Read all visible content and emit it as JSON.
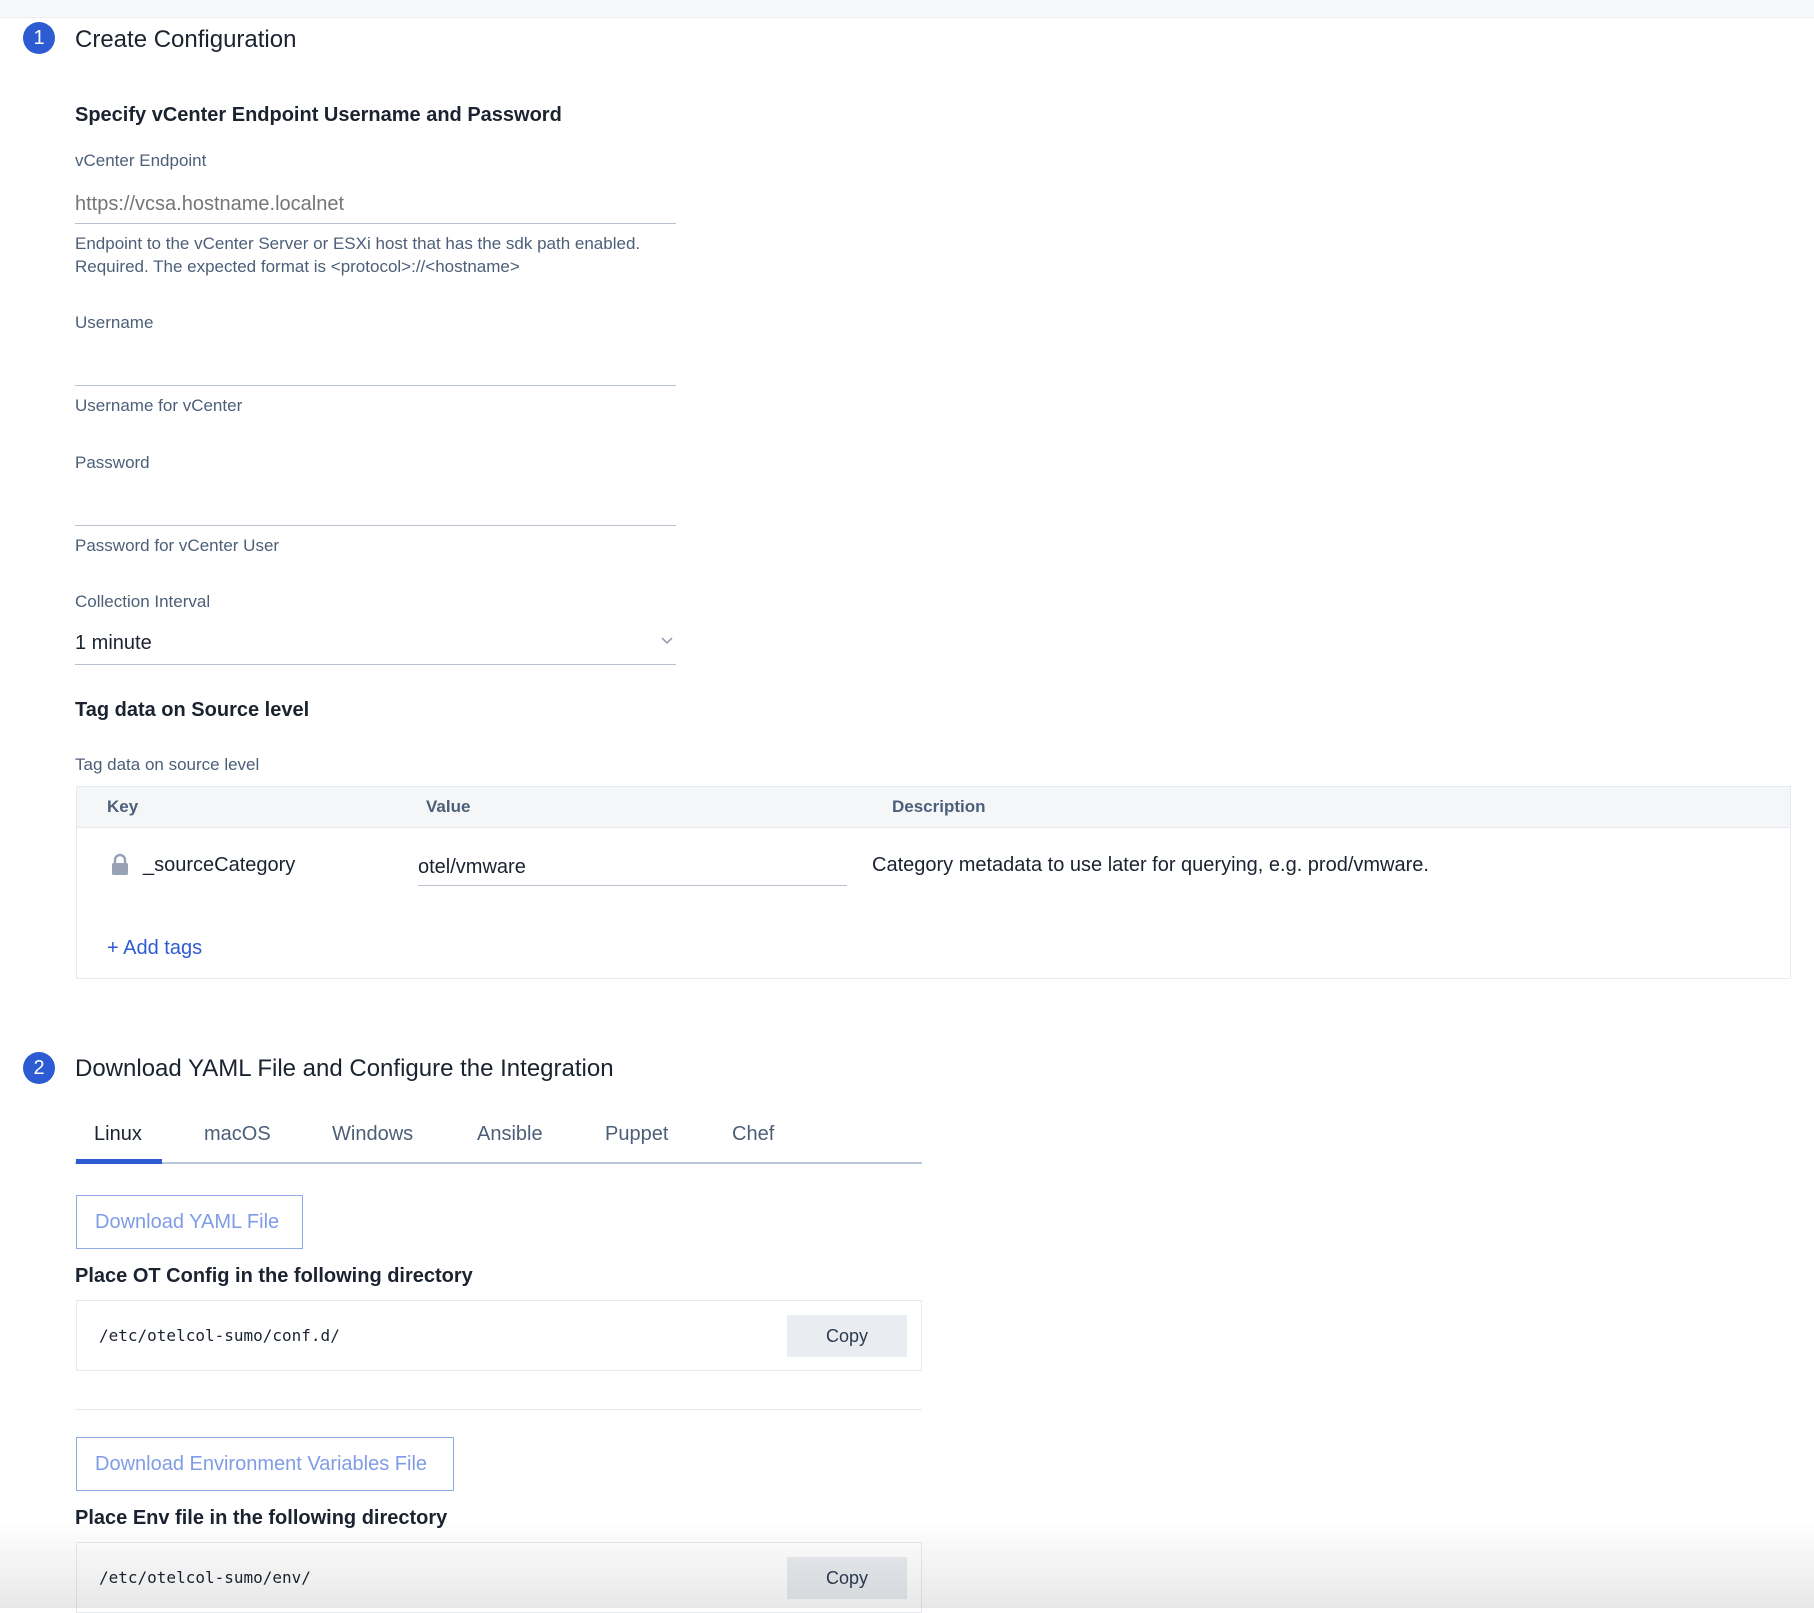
{
  "step1": {
    "number": "1",
    "title": "Create Configuration",
    "section_title": "Specify vCenter Endpoint Username and Password",
    "endpoint": {
      "label": "vCenter Endpoint",
      "placeholder": "https://vcsa.hostname.localnet",
      "value": "",
      "help_line1": "Endpoint to the vCenter Server or ESXi host that has the sdk path enabled.",
      "help_line2": "Required. The expected format is <protocol>://<hostname>"
    },
    "username": {
      "label": "Username",
      "value": "",
      "help": "Username for vCenter"
    },
    "password": {
      "label": "Password",
      "value": "",
      "help": "Password for vCenter User"
    },
    "collection_interval": {
      "label": "Collection Interval",
      "value": "1 minute",
      "icon": "chevron-down-icon"
    },
    "tags": {
      "heading": "Tag data on Source level",
      "label": "Tag data on source level",
      "columns": [
        "Key",
        "Value",
        "Description"
      ],
      "rows": [
        {
          "key": "_sourceCategory",
          "key_icon": "lock-icon",
          "value": "otel/vmware",
          "description": "Category metadata to use later for querying, e.g. prod/vmware."
        }
      ],
      "add_label": "+ Add tags"
    }
  },
  "step2": {
    "number": "2",
    "title": "Download YAML File and Configure the Integration",
    "tabs": [
      {
        "label": "Linux",
        "active": true
      },
      {
        "label": "macOS"
      },
      {
        "label": "Windows"
      },
      {
        "label": "Ansible"
      },
      {
        "label": "Puppet"
      },
      {
        "label": "Chef"
      }
    ],
    "download_yaml": "Download YAML File",
    "config_heading": "Place OT Config in the following directory",
    "config_path": "/etc/otelcol-sumo/conf.d/",
    "copy_label": "Copy",
    "download_env": "Download Environment Variables File",
    "env_heading": "Place Env file in the following directory",
    "env_path": "/etc/otelcol-sumo/env/"
  },
  "colors": {
    "accent": "#2c5bd2",
    "label": "#4c5f78"
  }
}
